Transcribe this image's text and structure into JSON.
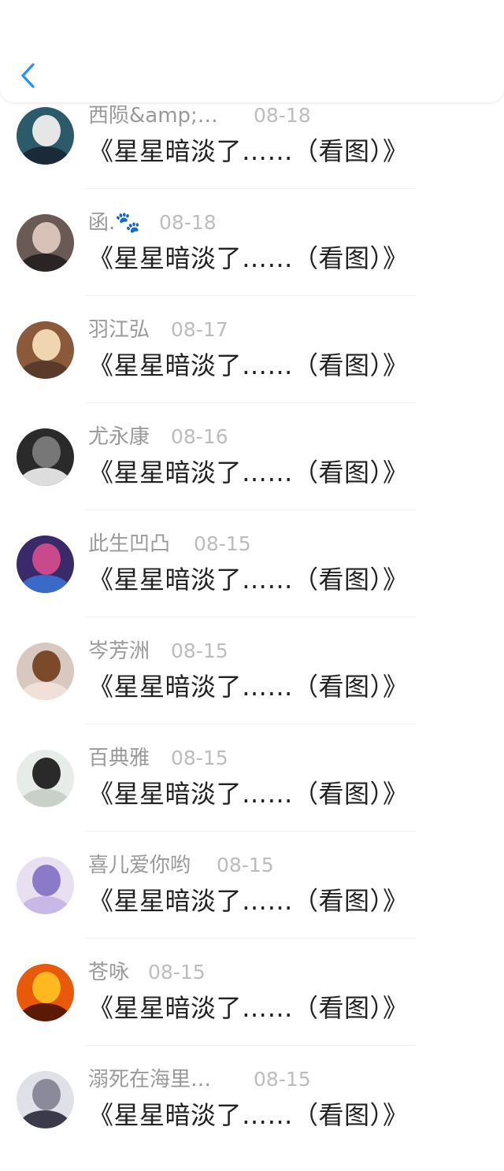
{
  "header": {
    "back_icon": "chevron-left-icon",
    "accent": "#2a95e8"
  },
  "posts": [
    {
      "name": "西陨&amp;…",
      "date": "08-18",
      "title": "《星星暗淡了……（看图）》",
      "avatar_colors": [
        "#2b5b6b",
        "#e6e6e6",
        "#1b2a38"
      ]
    },
    {
      "name": "函.🐾",
      "date": "08-18",
      "title": "《星星暗淡了……（看图）》",
      "avatar_colors": [
        "#6a5a55",
        "#d8c2b8",
        "#2a2424"
      ]
    },
    {
      "name": "羽江弘",
      "date": "08-17",
      "title": "《星星暗淡了……（看图）》",
      "avatar_colors": [
        "#8a5a3a",
        "#f0d6b0",
        "#5a3a2a"
      ]
    },
    {
      "name": "尤永康",
      "date": "08-16",
      "title": "《星星暗淡了……（看图）》",
      "avatar_colors": [
        "#2a2a2a",
        "#777777",
        "#dddddd"
      ]
    },
    {
      "name": "此生凹凸",
      "date": "08-15",
      "title": "《星星暗淡了……（看图）》",
      "avatar_colors": [
        "#3a2a6a",
        "#c84a8a",
        "#3a6ac8"
      ]
    },
    {
      "name": "岑芳洲",
      "date": "08-15",
      "title": "《星星暗淡了……（看图）》",
      "avatar_colors": [
        "#d8c8c0",
        "#7a4a2a",
        "#f0e0d8"
      ]
    },
    {
      "name": "百典雅",
      "date": "08-15",
      "title": "《星星暗淡了……（看图）》",
      "avatar_colors": [
        "#e8ece8",
        "#2a2a2a",
        "#c8d0c8"
      ]
    },
    {
      "name": "喜儿爱你哟",
      "date": "08-15",
      "title": "《星星暗淡了……（看图）》",
      "avatar_colors": [
        "#e8e0f0",
        "#8a7ac8",
        "#c8b8e8"
      ]
    },
    {
      "name": "苍咏",
      "date": "08-15",
      "title": "《星星暗淡了……（看图）》",
      "avatar_colors": [
        "#e85a0a",
        "#ffb820",
        "#5a1a05"
      ]
    },
    {
      "name": "溺死在海里…",
      "date": "08-15",
      "title": "《星星暗淡了……（看图）》",
      "avatar_colors": [
        "#e0e0e8",
        "#8a8a9a",
        "#3a3a4a"
      ]
    }
  ]
}
